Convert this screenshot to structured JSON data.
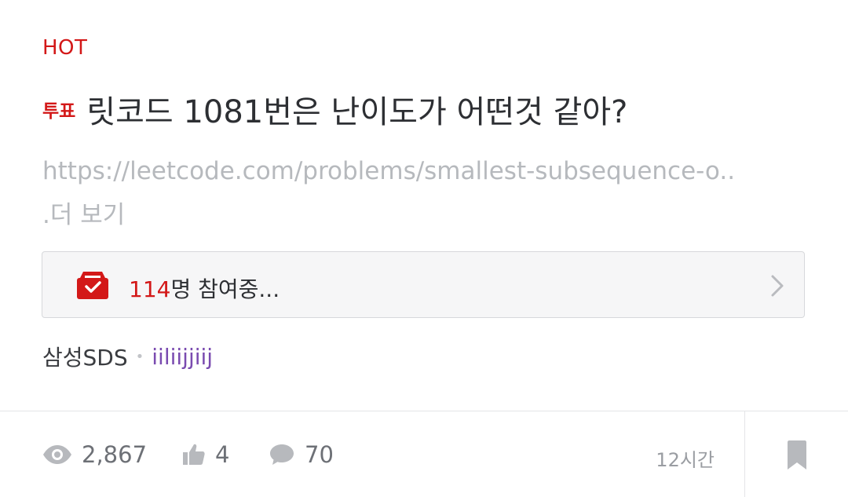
{
  "post": {
    "hot_label": "HOT",
    "vote_tag": "투표",
    "title": "릿코드 1081번은 난이도가 어떤것 같아?",
    "preview_line1": "https://leetcode.com/problems/smallest-subsequence-o..",
    "preview_line2": ".더 보기"
  },
  "poll": {
    "count": "114",
    "status_text": "명 참여중..."
  },
  "meta": {
    "company": "삼성SDS",
    "separator": "•",
    "author": "iiliijjiij"
  },
  "stats": {
    "views": "2,867",
    "likes": "4",
    "comments": "70",
    "time": "12시간"
  },
  "icons": {
    "poll": "ballot-box-icon",
    "chevron": "chevron-right-icon",
    "views": "eye-icon",
    "likes": "thumbs-up-icon",
    "comments": "comment-bubble-icon",
    "bookmark": "bookmark-icon"
  },
  "colors": {
    "accent_red": "#d31818",
    "author_purple": "#7a4bb0"
  }
}
